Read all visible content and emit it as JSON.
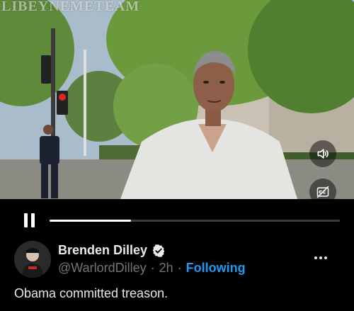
{
  "video": {
    "watermark": "LIBEYNEMETEAM",
    "volume_icon": "speaker-icon",
    "captions_icon": "captions-off-icon"
  },
  "player": {
    "state": "playing",
    "progress_fraction": 0.28,
    "pause_icon": "pause-icon"
  },
  "tweet": {
    "author_name": "Brenden Dilley",
    "handle": "@WarlordDilley",
    "separator": "·",
    "time_ago": "2h",
    "follow_status": "Following",
    "more_icon": "more-horizontal-icon",
    "verified_icon": "verified-badge-icon",
    "text": "Obama committed treason."
  },
  "colors": {
    "background": "#000000",
    "text_primary": "#e7e9ea",
    "text_secondary": "#71767b",
    "link_blue": "#1d9bf0",
    "progress_track": "#3a3d40",
    "progress_fill": "#ffffff"
  }
}
